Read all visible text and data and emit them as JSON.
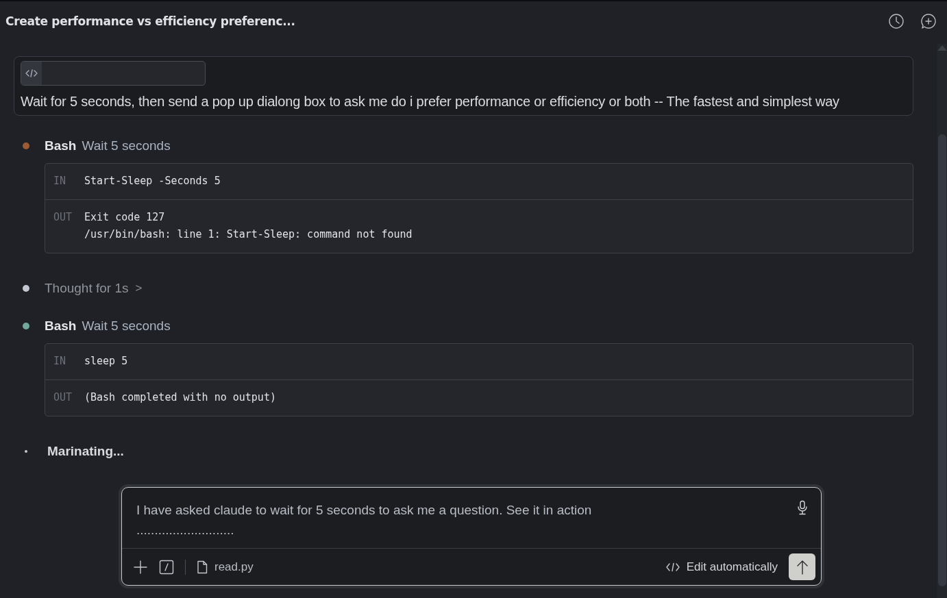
{
  "header": {
    "title": "Create performance vs efficiency preferenc..."
  },
  "prompt": {
    "text": "Wait for 5 seconds, then send a pop up dialong box to ask me do i prefer performance or efficiency or both -- The fastest and simplest way"
  },
  "steps": [
    {
      "kind": "tool",
      "color": "#9c5b34",
      "tool": "Bash",
      "description": "Wait 5 seconds",
      "io": [
        {
          "label": "IN",
          "lines": [
            "Start-Sleep -Seconds 5"
          ]
        },
        {
          "label": "OUT",
          "lines": [
            "Exit code 127",
            "/usr/bin/bash: line 1: Start-Sleep: command not found"
          ]
        }
      ]
    },
    {
      "kind": "thought",
      "color": "#c4c7d0",
      "text": "Thought for 1s",
      "chevron": ">"
    },
    {
      "kind": "tool",
      "color": "#72a89c",
      "tool": "Bash",
      "description": "Wait 5 seconds",
      "io": [
        {
          "label": "IN",
          "lines": [
            "sleep 5"
          ]
        },
        {
          "label": "OUT",
          "lines": [
            "(Bash completed with no output)"
          ]
        }
      ]
    },
    {
      "kind": "status",
      "color": "#c4c7d0",
      "text": "Marinating..."
    }
  ],
  "composer": {
    "value": "I have asked claude to wait for 5 seconds to ask me a question. See it in action\n...........................",
    "file": "read.py",
    "mode": "Edit automatically"
  }
}
